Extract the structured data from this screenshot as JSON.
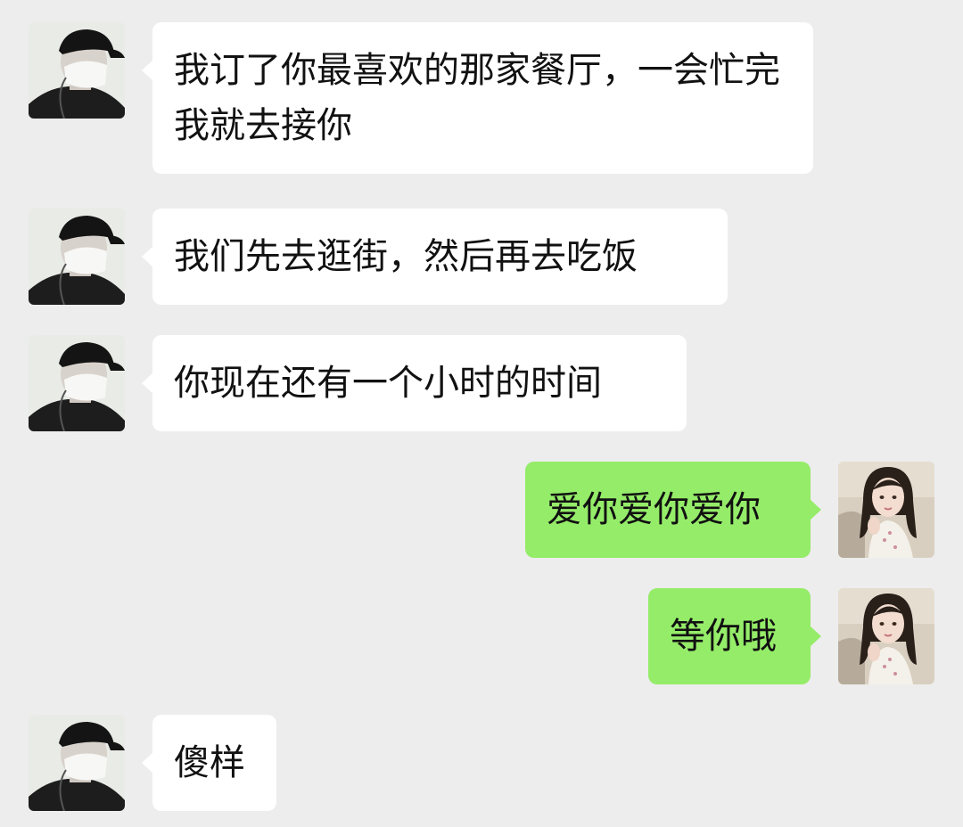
{
  "messages": [
    {
      "sender": "other",
      "avatar": "masked-man-avatar",
      "text": "我订了你最喜欢的那家餐厅，一会忙完我就去接你"
    },
    {
      "sender": "other",
      "avatar": "masked-man-avatar",
      "text": "我们先去逛街，然后再去吃饭"
    },
    {
      "sender": "other",
      "avatar": "masked-man-avatar",
      "text": "你现在还有一个小时的时间"
    },
    {
      "sender": "self",
      "avatar": "girl-photo-avatar",
      "text": "爱你爱你爱你"
    },
    {
      "sender": "self",
      "avatar": "girl-photo-avatar",
      "text": "等你哦"
    },
    {
      "sender": "other",
      "avatar": "masked-man-avatar",
      "text": "傻样"
    }
  ],
  "colors": {
    "background": "#ededed",
    "incoming_bubble": "#ffffff",
    "outgoing_bubble": "#95ec69",
    "text": "#111111"
  }
}
